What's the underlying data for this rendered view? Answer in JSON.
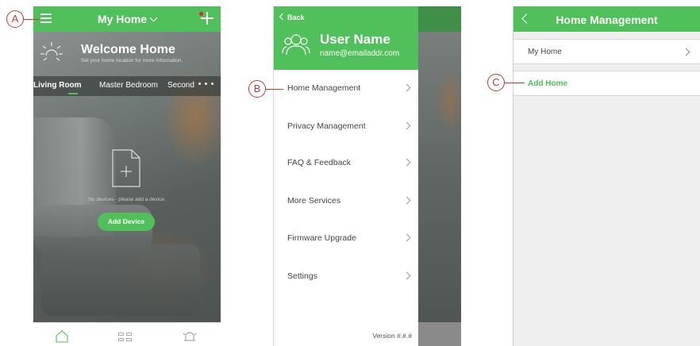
{
  "phone1": {
    "header_title": "My Home",
    "welcome_title": "Welcome Home",
    "welcome_subtitle": "Set your home location for more information.",
    "rooms": [
      "Living Room",
      "Master Bedroom",
      "Second"
    ],
    "empty_message": "No devices - please add a device.",
    "add_device_label": "Add Device",
    "icons": [
      "menu-icon",
      "chevron-down-icon",
      "plus-icon",
      "sun-icon",
      "more-icon",
      "add-device-icon",
      "home-icon",
      "grid-icon",
      "alarm-icon"
    ]
  },
  "phone2": {
    "back_label": "Back",
    "user_name": "User Name",
    "user_email": "name@emailaddr.com",
    "menu": [
      {
        "label": "Home Management"
      },
      {
        "label": "Privacy Management"
      },
      {
        "label": "FAQ & Feedback"
      },
      {
        "label": "More Services"
      },
      {
        "label": "Firmware Upgrade"
      },
      {
        "label": "Settings"
      }
    ],
    "version": "Version #.#.#"
  },
  "phone3": {
    "header_title": "Home Management",
    "homes": [
      {
        "label": "My Home"
      }
    ],
    "add_home_label": "Add Home"
  },
  "callouts": {
    "a": "A",
    "b": "B",
    "c": "C"
  },
  "colors": {
    "accent": "#4fc05a",
    "callout": "#c23a3a",
    "notification": "#e0262a"
  }
}
